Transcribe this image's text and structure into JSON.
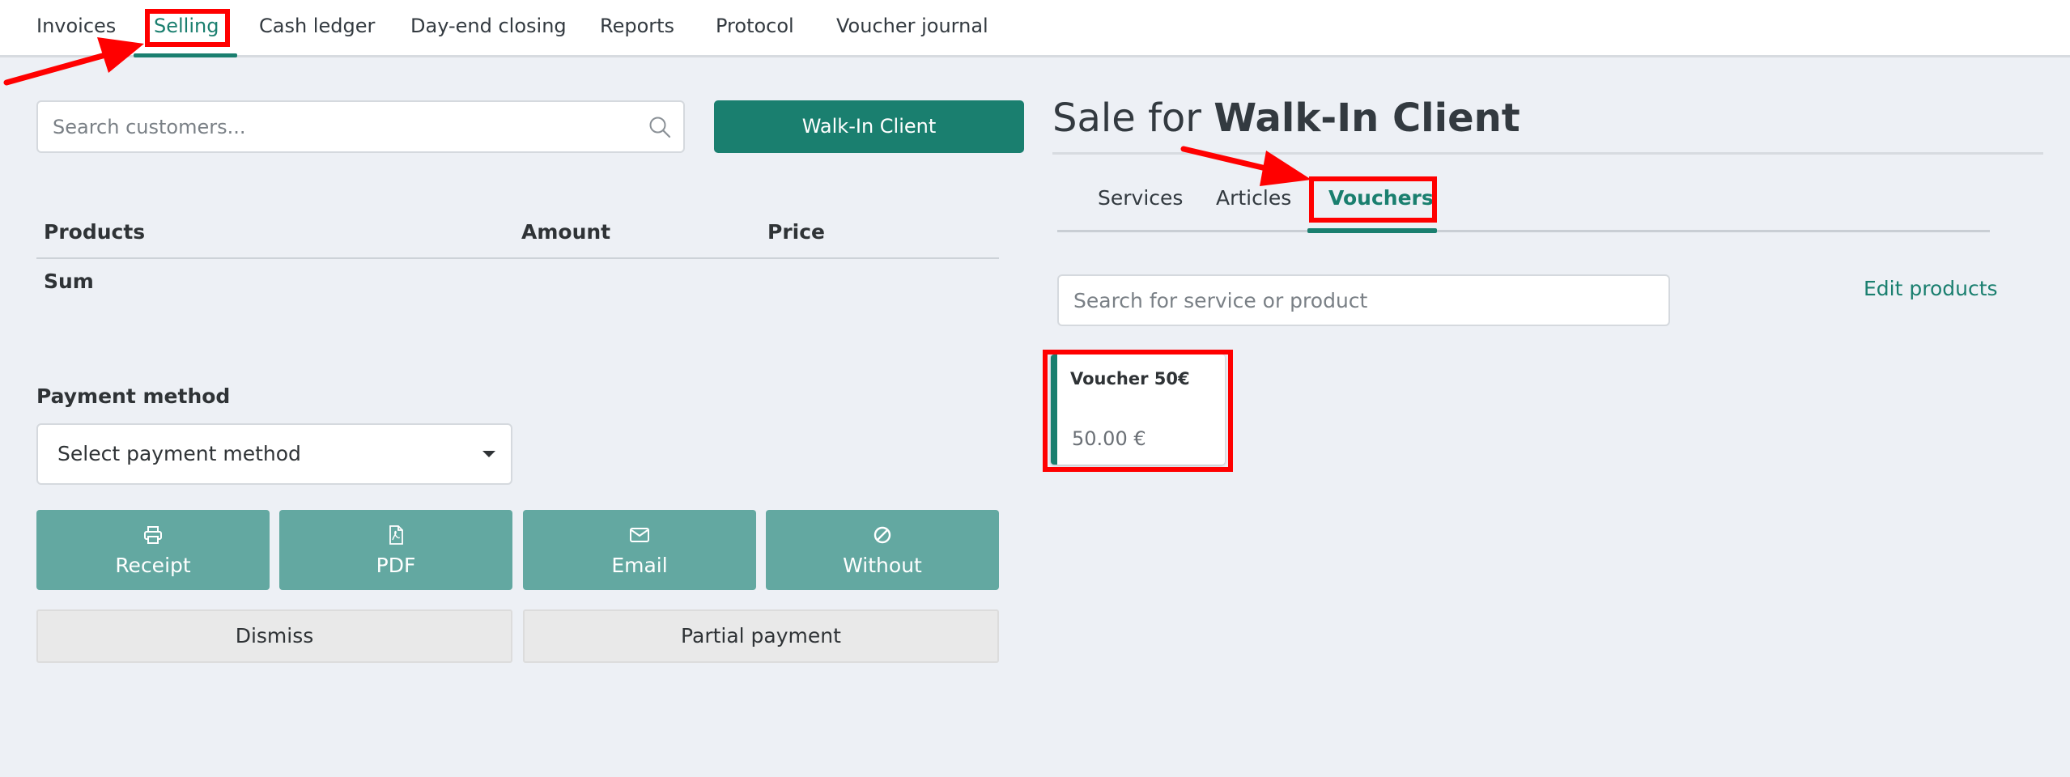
{
  "nav": {
    "items": [
      {
        "label": "Invoices"
      },
      {
        "label": "Selling"
      },
      {
        "label": "Cash ledger"
      },
      {
        "label": "Day-end closing"
      },
      {
        "label": "Reports"
      },
      {
        "label": "Protocol"
      },
      {
        "label": "Voucher journal"
      }
    ],
    "active": "Selling"
  },
  "left": {
    "customer_search_placeholder": "Search customers...",
    "walkin_button": "Walk-In Client",
    "table": {
      "headers": [
        "Products",
        "Amount",
        "Price"
      ],
      "sum_label": "Sum"
    },
    "payment": {
      "label": "Payment method",
      "selected": "Select payment method"
    },
    "actions": [
      {
        "label": "Receipt",
        "icon": "printer-icon"
      },
      {
        "label": "PDF",
        "icon": "pdf-file-icon"
      },
      {
        "label": "Email",
        "icon": "envelope-icon"
      },
      {
        "label": "Without",
        "icon": "ban-icon"
      }
    ],
    "dismiss_button": "Dismiss",
    "partial_button": "Partial payment"
  },
  "right": {
    "title_prefix": "Sale for",
    "title_client": "Walk-In Client",
    "tabs": [
      {
        "label": "Services"
      },
      {
        "label": "Articles"
      },
      {
        "label": "Vouchers"
      }
    ],
    "active_tab": "Vouchers",
    "product_search_placeholder": "Search for service or product",
    "edit_products": "Edit products",
    "products": [
      {
        "name": "Voucher 50€",
        "price": "50.00 €"
      }
    ]
  },
  "colors": {
    "accent": "#1a7f6f",
    "action_button": "#63a8a1",
    "background": "#edf0f5",
    "annotation": "#ff0000"
  }
}
